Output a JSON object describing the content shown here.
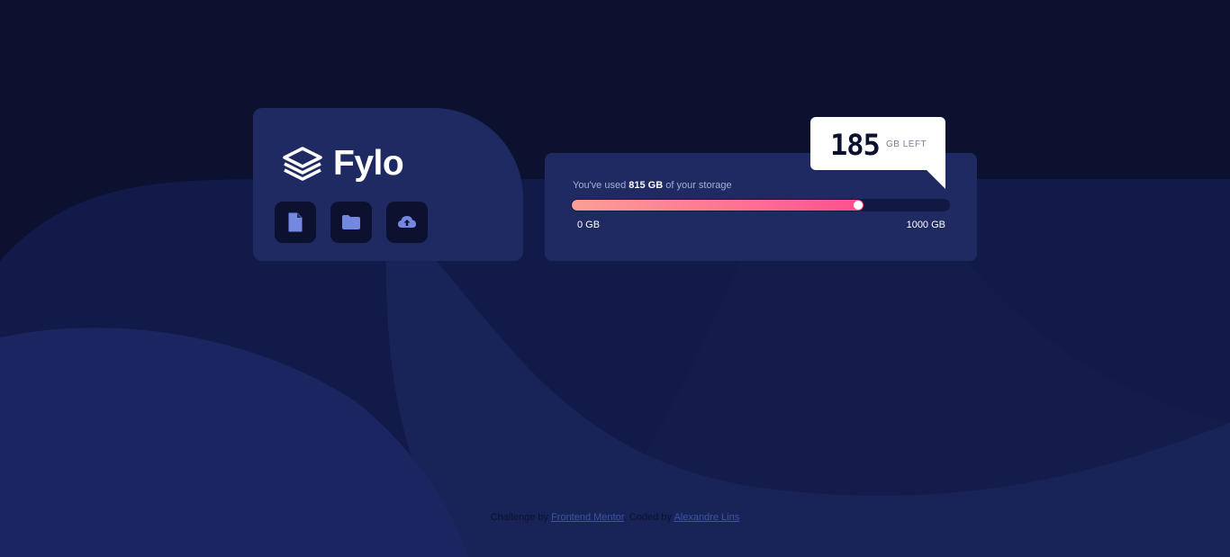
{
  "brand": {
    "name": "Fylo",
    "logo_icon": "stacked-layers-icon",
    "actions": [
      {
        "icon": "document-icon",
        "label": "Files"
      },
      {
        "icon": "folder-icon",
        "label": "Folders"
      },
      {
        "icon": "cloud-upload-icon",
        "label": "Upload"
      }
    ]
  },
  "storage": {
    "prefix": "You've used ",
    "used": "815 GB",
    "suffix": " of your storage",
    "used_fraction": 0.815,
    "min_label": "0 GB",
    "max_label": "1000 GB",
    "remaining_value": "185",
    "remaining_unit": "GB LEFT"
  },
  "attribution": {
    "prefix": "Challenge by ",
    "challenge_link": "Frontend Mentor",
    "middle": ". Coded by ",
    "author_link": "Alexandre Lins"
  },
  "colors": {
    "background": "#0c1130",
    "card": "#1f2a63",
    "gradient_start": "#fb9f96",
    "gradient_end": "#ff4f8f",
    "icon_accent": "#7388e0"
  }
}
